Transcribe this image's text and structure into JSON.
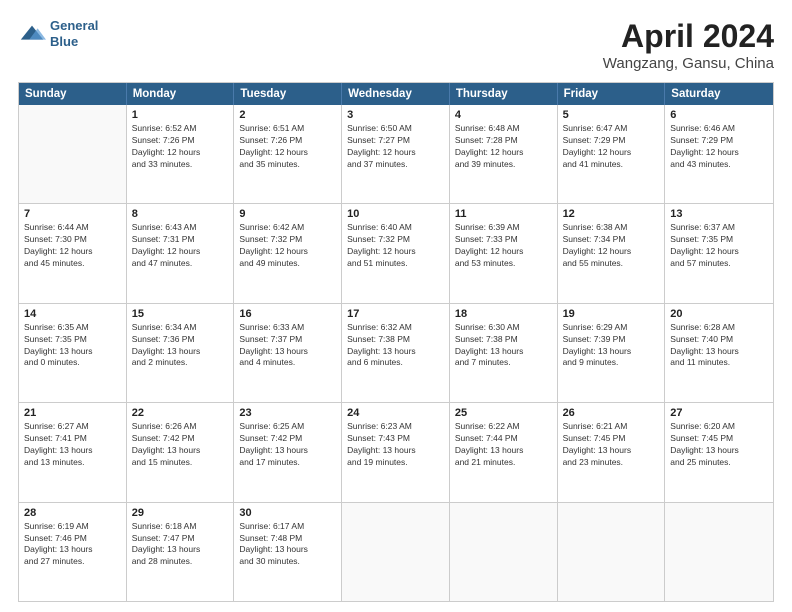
{
  "header": {
    "logo_line1": "General",
    "logo_line2": "Blue",
    "title": "April 2024",
    "subtitle": "Wangzang, Gansu, China"
  },
  "weekdays": [
    "Sunday",
    "Monday",
    "Tuesday",
    "Wednesday",
    "Thursday",
    "Friday",
    "Saturday"
  ],
  "weeks": [
    [
      {
        "day": "",
        "info": ""
      },
      {
        "day": "1",
        "info": "Sunrise: 6:52 AM\nSunset: 7:26 PM\nDaylight: 12 hours\nand 33 minutes."
      },
      {
        "day": "2",
        "info": "Sunrise: 6:51 AM\nSunset: 7:26 PM\nDaylight: 12 hours\nand 35 minutes."
      },
      {
        "day": "3",
        "info": "Sunrise: 6:50 AM\nSunset: 7:27 PM\nDaylight: 12 hours\nand 37 minutes."
      },
      {
        "day": "4",
        "info": "Sunrise: 6:48 AM\nSunset: 7:28 PM\nDaylight: 12 hours\nand 39 minutes."
      },
      {
        "day": "5",
        "info": "Sunrise: 6:47 AM\nSunset: 7:29 PM\nDaylight: 12 hours\nand 41 minutes."
      },
      {
        "day": "6",
        "info": "Sunrise: 6:46 AM\nSunset: 7:29 PM\nDaylight: 12 hours\nand 43 minutes."
      }
    ],
    [
      {
        "day": "7",
        "info": "Sunrise: 6:44 AM\nSunset: 7:30 PM\nDaylight: 12 hours\nand 45 minutes."
      },
      {
        "day": "8",
        "info": "Sunrise: 6:43 AM\nSunset: 7:31 PM\nDaylight: 12 hours\nand 47 minutes."
      },
      {
        "day": "9",
        "info": "Sunrise: 6:42 AM\nSunset: 7:32 PM\nDaylight: 12 hours\nand 49 minutes."
      },
      {
        "day": "10",
        "info": "Sunrise: 6:40 AM\nSunset: 7:32 PM\nDaylight: 12 hours\nand 51 minutes."
      },
      {
        "day": "11",
        "info": "Sunrise: 6:39 AM\nSunset: 7:33 PM\nDaylight: 12 hours\nand 53 minutes."
      },
      {
        "day": "12",
        "info": "Sunrise: 6:38 AM\nSunset: 7:34 PM\nDaylight: 12 hours\nand 55 minutes."
      },
      {
        "day": "13",
        "info": "Sunrise: 6:37 AM\nSunset: 7:35 PM\nDaylight: 12 hours\nand 57 minutes."
      }
    ],
    [
      {
        "day": "14",
        "info": "Sunrise: 6:35 AM\nSunset: 7:35 PM\nDaylight: 13 hours\nand 0 minutes."
      },
      {
        "day": "15",
        "info": "Sunrise: 6:34 AM\nSunset: 7:36 PM\nDaylight: 13 hours\nand 2 minutes."
      },
      {
        "day": "16",
        "info": "Sunrise: 6:33 AM\nSunset: 7:37 PM\nDaylight: 13 hours\nand 4 minutes."
      },
      {
        "day": "17",
        "info": "Sunrise: 6:32 AM\nSunset: 7:38 PM\nDaylight: 13 hours\nand 6 minutes."
      },
      {
        "day": "18",
        "info": "Sunrise: 6:30 AM\nSunset: 7:38 PM\nDaylight: 13 hours\nand 7 minutes."
      },
      {
        "day": "19",
        "info": "Sunrise: 6:29 AM\nSunset: 7:39 PM\nDaylight: 13 hours\nand 9 minutes."
      },
      {
        "day": "20",
        "info": "Sunrise: 6:28 AM\nSunset: 7:40 PM\nDaylight: 13 hours\nand 11 minutes."
      }
    ],
    [
      {
        "day": "21",
        "info": "Sunrise: 6:27 AM\nSunset: 7:41 PM\nDaylight: 13 hours\nand 13 minutes."
      },
      {
        "day": "22",
        "info": "Sunrise: 6:26 AM\nSunset: 7:42 PM\nDaylight: 13 hours\nand 15 minutes."
      },
      {
        "day": "23",
        "info": "Sunrise: 6:25 AM\nSunset: 7:42 PM\nDaylight: 13 hours\nand 17 minutes."
      },
      {
        "day": "24",
        "info": "Sunrise: 6:23 AM\nSunset: 7:43 PM\nDaylight: 13 hours\nand 19 minutes."
      },
      {
        "day": "25",
        "info": "Sunrise: 6:22 AM\nSunset: 7:44 PM\nDaylight: 13 hours\nand 21 minutes."
      },
      {
        "day": "26",
        "info": "Sunrise: 6:21 AM\nSunset: 7:45 PM\nDaylight: 13 hours\nand 23 minutes."
      },
      {
        "day": "27",
        "info": "Sunrise: 6:20 AM\nSunset: 7:45 PM\nDaylight: 13 hours\nand 25 minutes."
      }
    ],
    [
      {
        "day": "28",
        "info": "Sunrise: 6:19 AM\nSunset: 7:46 PM\nDaylight: 13 hours\nand 27 minutes."
      },
      {
        "day": "29",
        "info": "Sunrise: 6:18 AM\nSunset: 7:47 PM\nDaylight: 13 hours\nand 28 minutes."
      },
      {
        "day": "30",
        "info": "Sunrise: 6:17 AM\nSunset: 7:48 PM\nDaylight: 13 hours\nand 30 minutes."
      },
      {
        "day": "",
        "info": ""
      },
      {
        "day": "",
        "info": ""
      },
      {
        "day": "",
        "info": ""
      },
      {
        "day": "",
        "info": ""
      }
    ]
  ]
}
